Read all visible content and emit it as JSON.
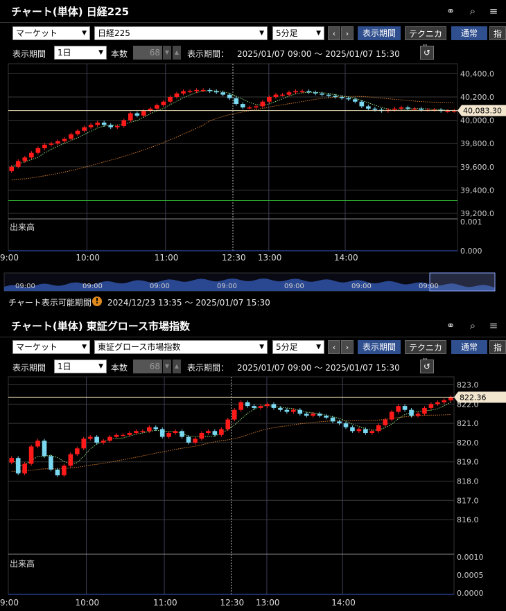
{
  "panels": [
    {
      "title": "チャート(単体) 日経225",
      "market_select": "マーケット",
      "symbol_select": "日経225",
      "interval_select": "5分足",
      "prev_label": "‹",
      "next_label": "›",
      "period_button": "表示期間",
      "technical_button": "テクニカル",
      "normal_button": "通常",
      "index_button": "指",
      "period_label": "表示期間",
      "period_value": "1日",
      "count_label": "本数",
      "count_value": "68",
      "range_label": "表示期間：",
      "range_value": "2025/01/07 09:00 ～ 2025/01/07 15:30",
      "y_ticks": [
        "40,400.0",
        "40,200.0",
        "40,000.0",
        "39,800.0",
        "39,600.0",
        "39,400.0",
        "39,200.0"
      ],
      "price_tag": "40,083.30",
      "volume_label": "出来高",
      "volume_ticks": [
        "0.001",
        "0.000"
      ],
      "x_ticks": [
        "9:00",
        "10:00",
        "11:00",
        "12:30",
        "13:00",
        "14:00"
      ],
      "navigator_ticks": [
        "09:00",
        "09:00",
        "09:00",
        "09:00",
        "09:00",
        "09:00",
        "09:00"
      ],
      "available_label": "チャート表示可能期間",
      "available_value": "2024/12/23 13:35 ～ 2025/01/07 15:30"
    },
    {
      "title": "チャート(単体) 東証グロース市場指数",
      "market_select": "マーケット",
      "symbol_select": "東証グロース市場指数",
      "interval_select": "5分足",
      "prev_label": "‹",
      "next_label": "›",
      "period_button": "表示期間",
      "technical_button": "テクニカル",
      "normal_button": "通常",
      "index_button": "指",
      "period_label": "表示期間",
      "period_value": "1日",
      "count_label": "本数",
      "count_value": "68",
      "range_label": "表示期間：",
      "range_value": "2025/01/07 09:00 ～ 2025/01/07 15:30",
      "y_ticks": [
        "823.0",
        "822.0",
        "821.0",
        "820.0",
        "819.0",
        "818.0",
        "817.0",
        "816.0"
      ],
      "price_tag": "822.36",
      "volume_label": "出来高",
      "volume_ticks": [
        "0.0010",
        "0.0005",
        "0.0000"
      ],
      "x_ticks": [
        "9:00",
        "10:00",
        "11:00",
        "12:30",
        "13:00",
        "14:00"
      ]
    }
  ],
  "chart_data": [
    {
      "type": "candlestick",
      "title": "チャート(単体) 日経225",
      "x_categories": [
        "9:00",
        "10:00",
        "11:00",
        "12:30",
        "13:00",
        "14:00"
      ],
      "ylim": [
        39200,
        40450
      ],
      "last_price": 40083.3,
      "reference_line": 39310,
      "candles_close": [
        39600,
        39650,
        39680,
        39720,
        39760,
        39790,
        39800,
        39820,
        39840,
        39880,
        39910,
        39940,
        39960,
        39980,
        39960,
        39940,
        39950,
        40000,
        40060,
        40040,
        40080,
        40100,
        40130,
        40160,
        40200,
        40230,
        40250,
        40250,
        40260,
        40260,
        40250,
        40240,
        40220,
        40190,
        40140,
        40110,
        40110,
        40120,
        40160,
        40200,
        40220,
        40220,
        40240,
        40250,
        40250,
        40240,
        40230,
        40220,
        40210,
        40200,
        40190,
        40180,
        40160,
        40120,
        40100,
        40090,
        40080,
        40090,
        40100,
        40110,
        40100,
        40100,
        40090,
        40090,
        40090,
        40080,
        40080,
        40083
      ]
    },
    {
      "type": "candlestick",
      "title": "チャート(単体) 東証グロース市場指数",
      "x_categories": [
        "9:00",
        "10:00",
        "11:00",
        "12:30",
        "13:00",
        "14:00"
      ],
      "ylim": [
        815.5,
        823.2
      ],
      "last_price": 822.36,
      "candles_close": [
        819.2,
        818.4,
        818.9,
        819.8,
        820.1,
        819.3,
        818.6,
        818.3,
        818.8,
        819.4,
        819.7,
        820.2,
        820.3,
        820.0,
        820.1,
        820.3,
        820.4,
        820.4,
        820.5,
        820.6,
        820.6,
        820.8,
        820.7,
        820.3,
        820.5,
        820.6,
        820.3,
        820.0,
        820.2,
        820.5,
        820.6,
        820.4,
        820.7,
        821.2,
        821.7,
        822.1,
        821.9,
        821.8,
        821.9,
        822.0,
        821.8,
        821.7,
        821.6,
        821.7,
        821.5,
        821.4,
        821.5,
        821.4,
        821.3,
        821.1,
        821.0,
        820.8,
        820.6,
        820.7,
        820.5,
        820.6,
        820.9,
        821.2,
        821.6,
        821.9,
        821.7,
        821.4,
        821.5,
        821.8,
        822.0,
        822.1,
        822.2,
        822.36
      ]
    }
  ]
}
